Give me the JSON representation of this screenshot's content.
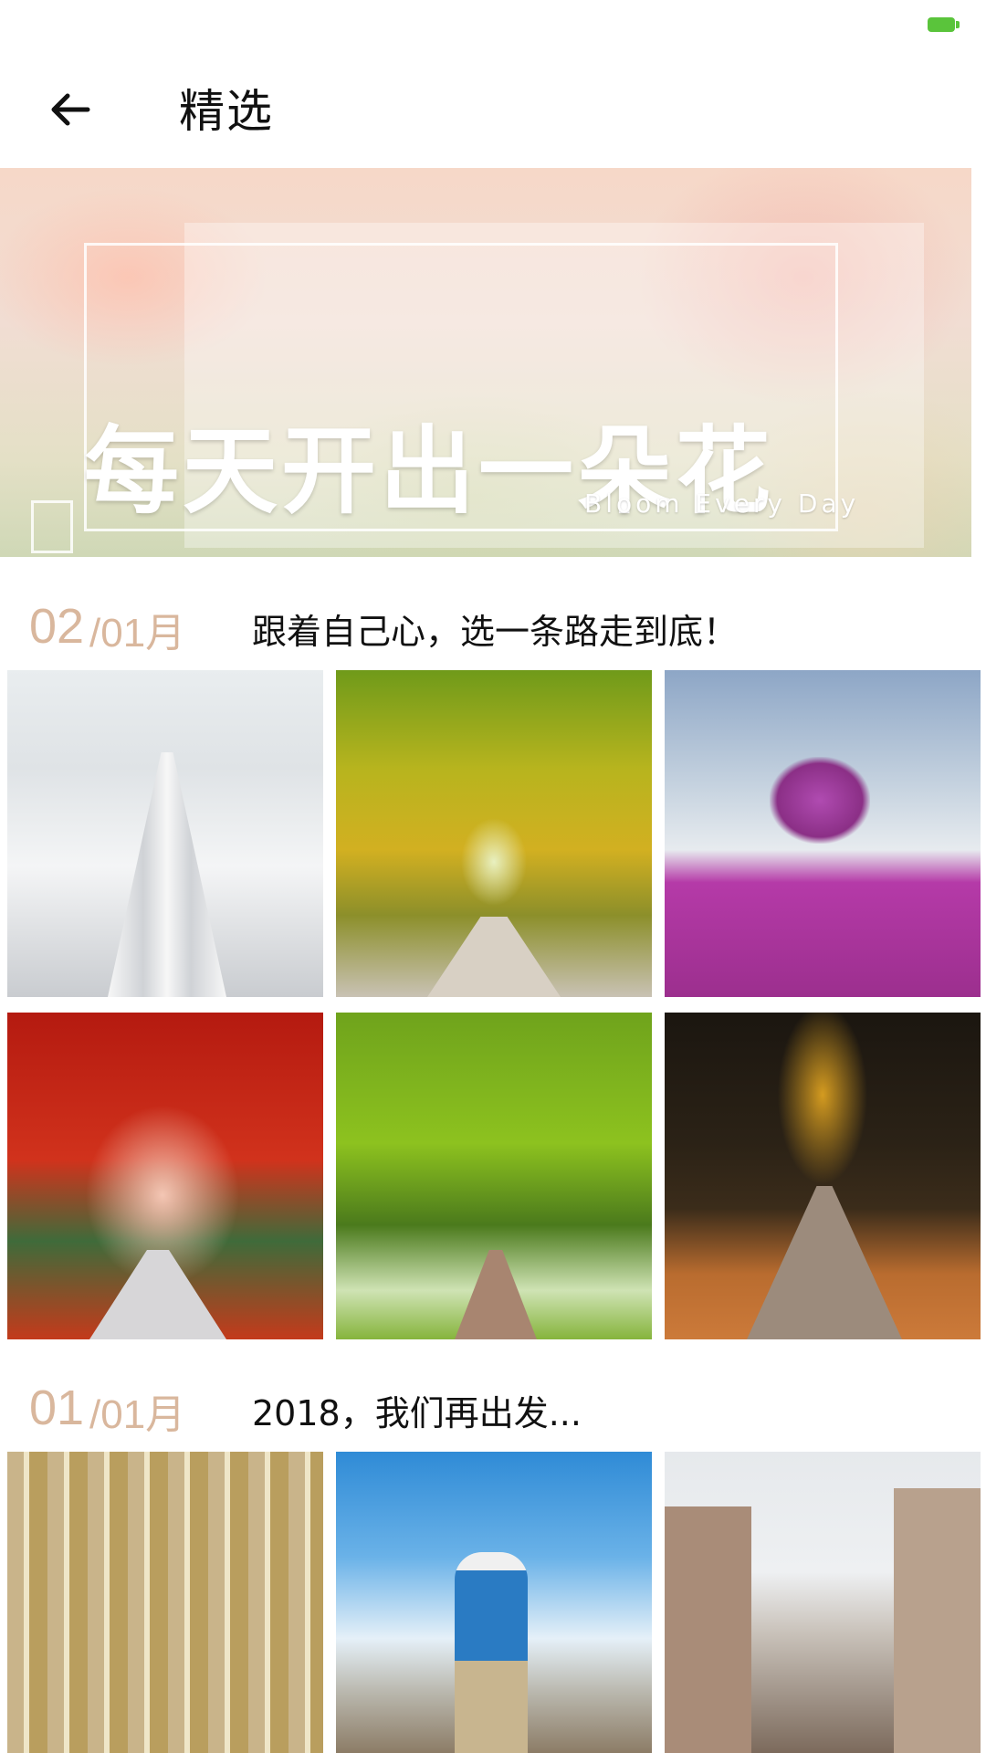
{
  "status_bar": {
    "battery_icon": "battery-icon",
    "battery_color": "#5ac43b"
  },
  "app_bar": {
    "back_icon": "arrow-left-icon",
    "title": "精选"
  },
  "banner": {
    "title": "每天开出一朵花",
    "subtitle": "Bloom Every Day"
  },
  "sections": [
    {
      "day": "02",
      "month": "/01月",
      "caption": "跟着自己心，选一条路走到底！",
      "photos": [
        "snowy-road-photo",
        "golden-tree-tunnel-photo",
        "purple-field-tree-photo",
        "red-autumn-road-photo",
        "green-forest-path-photo",
        "dark-autumn-forest-road-photo"
      ]
    },
    {
      "day": "01",
      "month": "/01月",
      "caption": "2018，我们再出发...",
      "photos": [
        "birch-forest-jumper-photo",
        "mountain-hiker-photo",
        "city-street-jumper-photo"
      ]
    }
  ],
  "colors": {
    "accent_date": "#d9b79d",
    "title_text": "#111111"
  }
}
